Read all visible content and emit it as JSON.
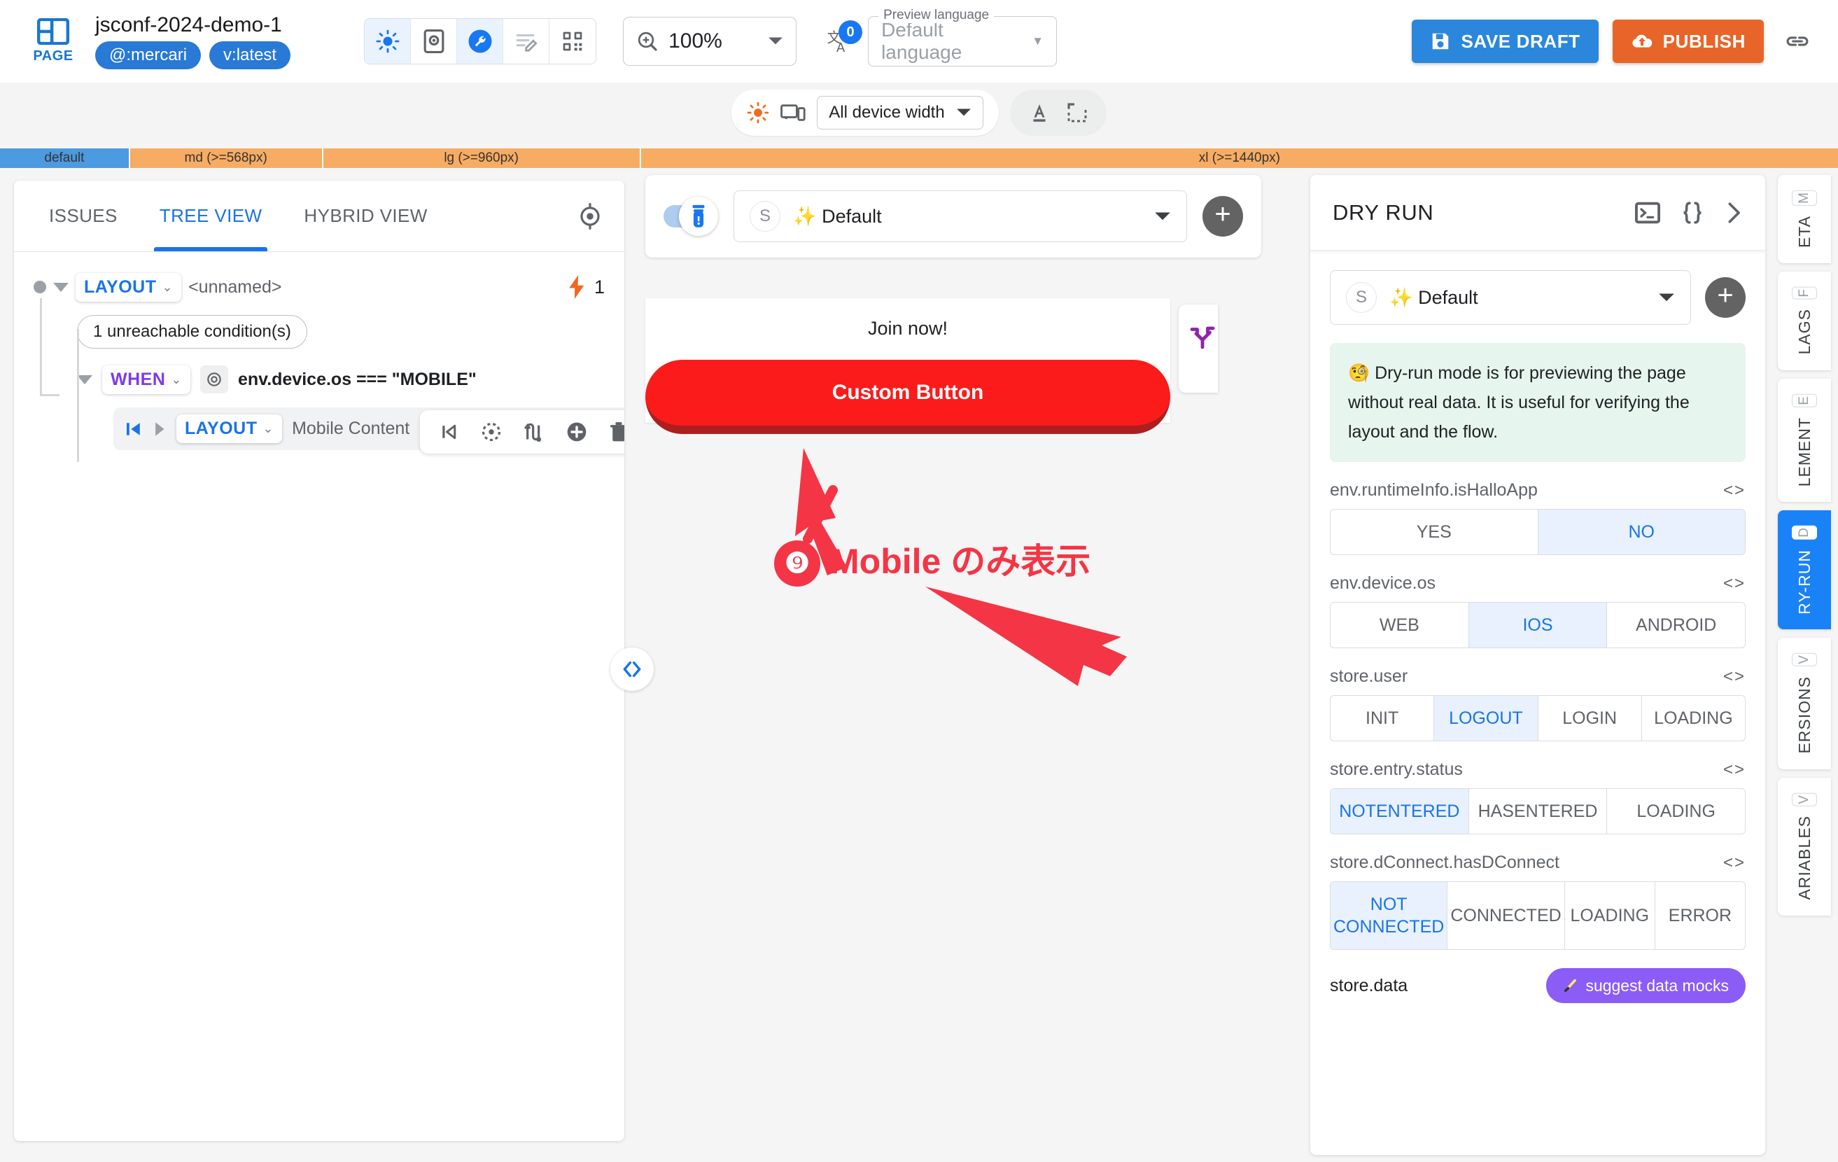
{
  "topbar": {
    "page_label": "PAGE",
    "title": "jsconf-2024-demo-1",
    "chips": [
      "@:mercari",
      "v:latest"
    ],
    "tools": [
      {
        "name": "theme-icon",
        "active": true
      },
      {
        "name": "preview-device-icon",
        "active": false
      },
      {
        "name": "wrench-icon",
        "active": true
      },
      {
        "name": "edit-list-icon",
        "active": false
      },
      {
        "name": "qr-code-icon",
        "active": false
      }
    ],
    "zoom_value": "100%",
    "translate_badge": "0",
    "preview_language_legend": "Preview language",
    "preview_language_value": "Default language",
    "save_draft_label": "SAVE DRAFT",
    "publish_label": "PUBLISH",
    "link_icon": "link-icon"
  },
  "subbar": {
    "device_width_value": "All device width",
    "sun_icon": "brightness-icon",
    "devices_icon": "devices-icon",
    "text_icon": "text-format-icon",
    "frame_icon": "frame-outline-icon"
  },
  "breakpoints": [
    {
      "label": "default",
      "width_pct": 7.0,
      "color": "#4c9ae0"
    },
    {
      "label": "md (>=568px)",
      "width_pct": 10.5,
      "color": "#f7ac63"
    },
    {
      "label": "lg (>=960px)",
      "width_pct": 17.3,
      "color": "#f7ac63"
    },
    {
      "label": "xl (>=1440px)",
      "width_pct": 65.2,
      "color": "#f7ac63"
    }
  ],
  "left_panel": {
    "tabs": [
      {
        "label": "ISSUES",
        "active": false
      },
      {
        "label": "TREE VIEW",
        "active": true
      },
      {
        "label": "HYBRID VIEW",
        "active": false
      }
    ],
    "target_icon": "crosshair-icon",
    "tree": {
      "root_tag": "LAYOUT",
      "root_name": "<unnamed>",
      "issue_count": "1",
      "issue_icon": "lightning-icon",
      "unreachable_label": "1 unreachable condition(s)",
      "when_tag": "WHEN",
      "when_condition": "env.device.os === \"MOBILE\"",
      "child_tag": "LAYOUT",
      "child_name": "Mobile Content",
      "row_actions": [
        "skip-previous-icon",
        "target-dashed-icon",
        "swap-paths-icon",
        "add-circle-icon",
        "delete-icon"
      ]
    }
  },
  "collapse_handle_icon": "code-brackets-icon",
  "center": {
    "toggle_icon": "device-preview-icon",
    "variant_avatar": "S",
    "variant_label": "✨ Default",
    "add_icon": "plus-icon",
    "preview": {
      "heading": "Join now!",
      "button_label": "Custom Button",
      "side_card_icon": "branch-fork-icon"
    },
    "annotation": {
      "number": "❾",
      "text": "Mobile のみ表示",
      "color": "#f43545"
    }
  },
  "right_panel": {
    "title": "DRY RUN",
    "head_icons": [
      "terminal-icon",
      "curly-braces-icon",
      "chevron-right-icon"
    ],
    "variant_avatar": "S",
    "variant_label": "✨ Default",
    "add_icon": "plus-icon",
    "info_text": "🧐 Dry-run mode is for previewing the page without real data. It is useful for verifying the layout and the flow.",
    "fields": [
      {
        "label": "env.runtimeInfo.isHalloApp",
        "options": [
          "YES",
          "NO"
        ],
        "selected": "NO",
        "tall": false
      },
      {
        "label": "env.device.os",
        "options": [
          "WEB",
          "IOS",
          "ANDROID"
        ],
        "selected": "IOS",
        "tall": false
      },
      {
        "label": "store.user",
        "options": [
          "INIT",
          "LOGOUT",
          "LOGIN",
          "LOADING"
        ],
        "selected": "LOGOUT",
        "tall": false
      },
      {
        "label": "store.entry.status",
        "options": [
          "NOTENTERED",
          "HASENTERED",
          "LOADING"
        ],
        "selected": "NOTENTERED",
        "tall": false
      },
      {
        "label": "store.dConnect.hasDConnect",
        "options": [
          "NOT CONNECTED",
          "CONNECTED",
          "LOADING",
          "ERROR"
        ],
        "selected": "NOT CONNECTED",
        "tall": true
      }
    ],
    "store_data_label": "store.data",
    "mock_button_label": "suggest data mocks",
    "mock_button_icon": "magic-wand-icon"
  },
  "rail": [
    {
      "key": "M",
      "label": "ETA",
      "active": false
    },
    {
      "key": "F",
      "label": "LAGS",
      "active": false
    },
    {
      "key": "E",
      "label": "LEMENT",
      "active": false
    },
    {
      "key": "D",
      "label": "RY-RUN",
      "active": true
    },
    {
      "key": "V",
      "label": "ERSIONS",
      "active": false
    },
    {
      "key": "V",
      "label": "ARIABLES",
      "active": false
    }
  ]
}
